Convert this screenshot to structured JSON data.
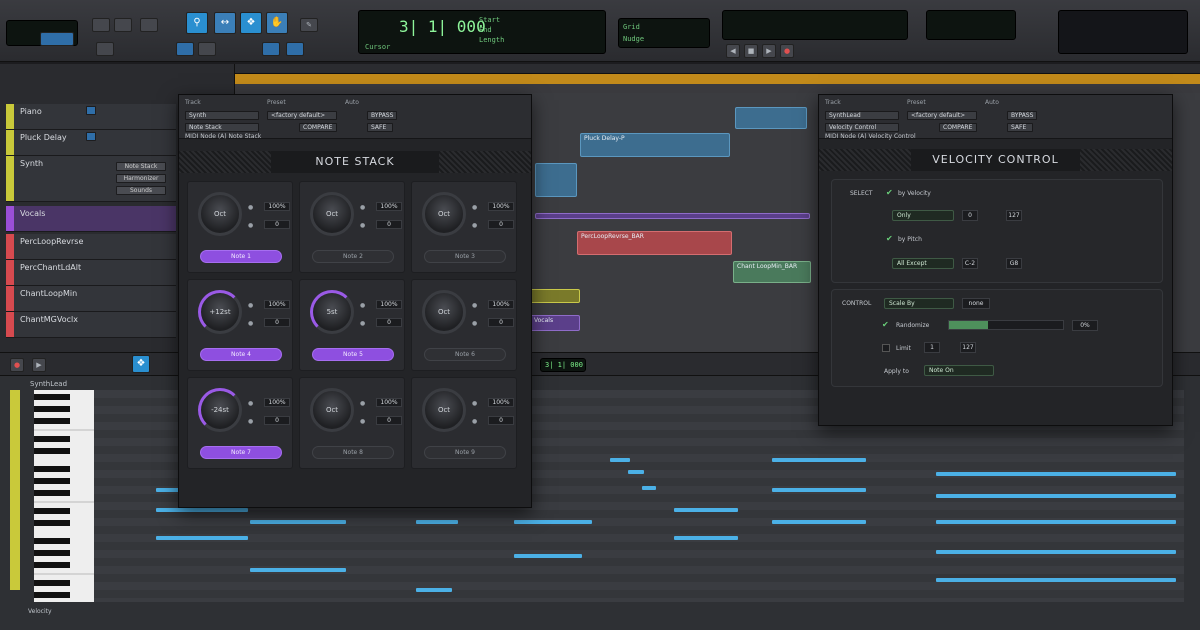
{
  "transport": {
    "counter": "3| 1| 000",
    "counter_labels": [
      "Start",
      "End",
      "Length"
    ],
    "cursor_label": "Cursor",
    "nudge_label": "Nudge",
    "grid_label": "Grid",
    "tools": [
      "zoom-icon",
      "trim-icon",
      "select-icon",
      "grab-icon",
      "pencil-icon"
    ]
  },
  "tracks": [
    {
      "name": "Piano",
      "color": "#c9c93a"
    },
    {
      "name": "Pluck Delay",
      "color": "#c9c93a"
    },
    {
      "name": "Synth",
      "color": "#c9c93a"
    },
    {
      "name": "Vocals",
      "color": "#9a4fd6"
    },
    {
      "name": "PercLoopRevrse",
      "color": "#d64a4f"
    },
    {
      "name": "PercChantLdAlt",
      "color": "#d64a4f"
    },
    {
      "name": "ChantLoopMin",
      "color": "#d64a4f"
    },
    {
      "name": "ChantMGVoclx",
      "color": "#d64a4f"
    }
  ],
  "synth_track_buttons": [
    "Note Stack",
    "Harmonizer",
    "Sounds"
  ],
  "clips": {
    "pluck": "Pluck Delay-P",
    "perc": "PercLoopRevrse_BAR",
    "chant": "Chant LoopMin_BAR",
    "vocals": "Vocals"
  },
  "note_stack": {
    "title": "NOTE STACK",
    "header": {
      "track_label": "Track",
      "preset_label": "Preset",
      "auto_label": "Auto",
      "track_value": "Synth",
      "insert_value": "Note Stack",
      "preset_value": "<factory default>",
      "compare": "COMPARE",
      "bypass": "BYPASS",
      "safe": "SAFE",
      "midi_path": "MIDI Node (A) Note Stack"
    },
    "cells": [
      {
        "knob": "Oct",
        "a": "100%",
        "b": "0",
        "note": "Note 1",
        "on": true,
        "lit": false
      },
      {
        "knob": "Oct",
        "a": "100%",
        "b": "0",
        "note": "Note 2",
        "on": false,
        "lit": false
      },
      {
        "knob": "Oct",
        "a": "100%",
        "b": "0",
        "note": "Note 3",
        "on": false,
        "lit": false
      },
      {
        "knob": "+12st",
        "a": "100%",
        "b": "0",
        "note": "Note 4",
        "on": true,
        "lit": true
      },
      {
        "knob": "5st",
        "a": "100%",
        "b": "0",
        "note": "Note 5",
        "on": true,
        "lit": true
      },
      {
        "knob": "Oct",
        "a": "100%",
        "b": "0",
        "note": "Note 6",
        "on": false,
        "lit": false
      },
      {
        "knob": "-24st",
        "a": "100%",
        "b": "0",
        "note": "Note 7",
        "on": true,
        "lit": true
      },
      {
        "knob": "Oct",
        "a": "100%",
        "b": "0",
        "note": "Note 8",
        "on": false,
        "lit": false
      },
      {
        "knob": "Oct",
        "a": "100%",
        "b": "0",
        "note": "Note 9",
        "on": false,
        "lit": false
      }
    ]
  },
  "velocity_control": {
    "title": "VELOCITY CONTROL",
    "header": {
      "track_label": "Track",
      "preset_label": "Preset",
      "auto_label": "Auto",
      "track_value": "SynthLead",
      "insert_value": "Velocity Control",
      "preset_value": "<factory default>",
      "compare": "COMPARE",
      "bypass": "BYPASS",
      "safe": "SAFE",
      "midi_path": "MIDI Node (A) Velocity Control"
    },
    "select_label": "SELECT",
    "by_velocity": "by Velocity",
    "only": "Only",
    "vel_min": "0",
    "vel_max": "127",
    "by_pitch": "by Pitch",
    "all_except": "All Except",
    "pitch_min": "C-2",
    "pitch_max": "G8",
    "control_label": "CONTROL",
    "control_mode": "Scale By",
    "control_value": "none",
    "randomize": "Randomize",
    "randomize_pct": "0%",
    "limit": "Limit",
    "limit_min": "1",
    "limit_max": "127",
    "apply_to": "Apply to",
    "apply_value": "Note On"
  },
  "editor": {
    "track_name": "SynthLead",
    "position": "3| 1| 000",
    "velocity_label": "Velocity"
  }
}
